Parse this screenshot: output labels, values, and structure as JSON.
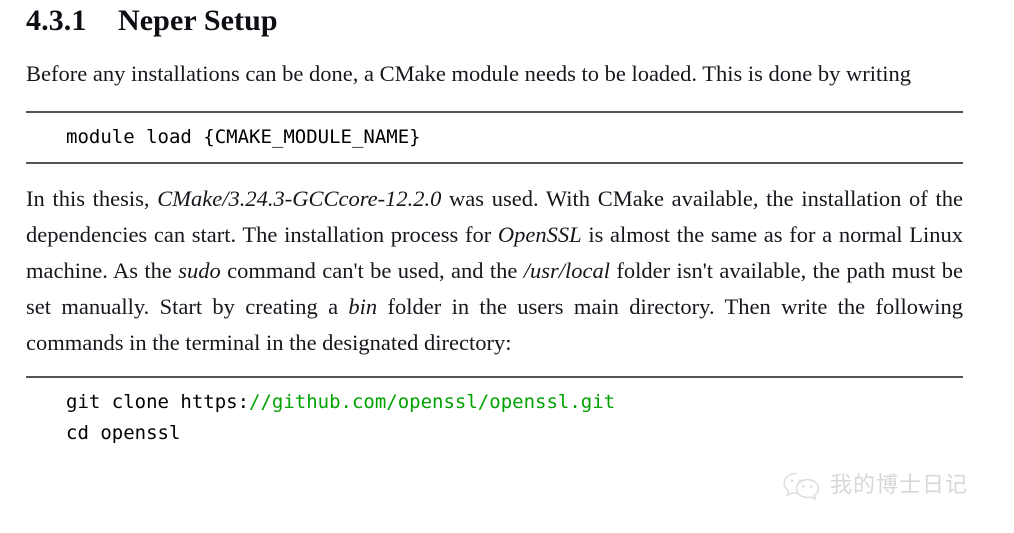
{
  "document": {
    "heading": {
      "number": "4.3.1",
      "title": "Neper Setup"
    },
    "paragraphs": {
      "intro": {
        "full_text": "Before any installations can be done, a CMake module needs to be loaded. This is done by writing"
      },
      "main": {
        "part1": "In this thesis, ",
        "emph1": "CMake/3.24.3-GCCcore-12.2.0",
        "part2": " was used. With CMake available, the installation of the dependencies can start. The installation process for ",
        "emph2": "OpenSSL",
        "part3": " is almost the same as for a normal Linux machine. As the ",
        "emph3": "sudo",
        "part4": " command can't be used, and the ",
        "emph4": "/usr/local",
        "part5": " folder isn't available, the path must be set manually. Start by creating a ",
        "emph5": "bin",
        "part6": " folder in the users main directory. Then write the following commands in the terminal in the designated directory:"
      }
    },
    "code_blocks": [
      {
        "id": "cmake-module-load",
        "lines": [
          {
            "text": "module load {CMAKE_MODULE_NAME}"
          }
        ]
      },
      {
        "id": "openssl-clone",
        "lines": [
          {
            "prefix": "git clone https:",
            "url": "//github.com/openssl/openssl.git"
          },
          {
            "prefix": "cd openssl",
            "url": ""
          }
        ]
      }
    ],
    "watermark": {
      "icon": "wechat-logo-icon",
      "text": "我的博士日记"
    },
    "colors": {
      "url_green": "#00a200",
      "rule_gray": "#555555",
      "watermark_gray": "#d8d8d8",
      "body_text": "#16161d"
    }
  }
}
